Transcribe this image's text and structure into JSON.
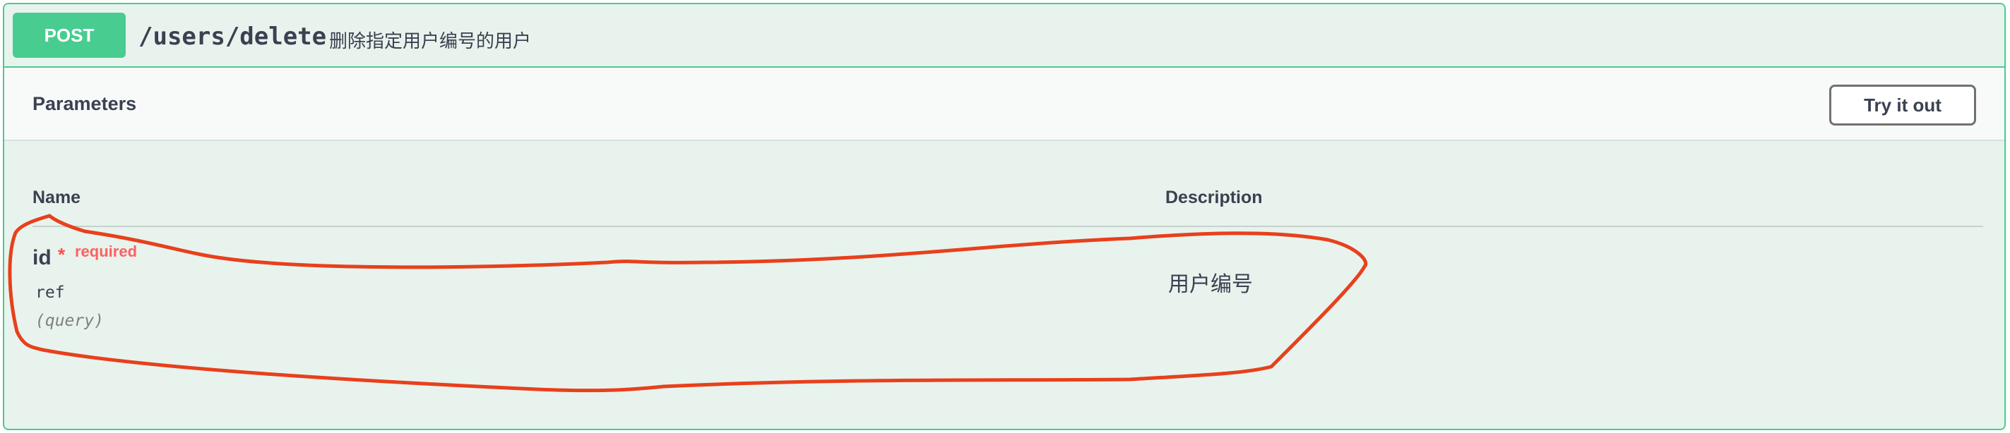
{
  "operation": {
    "method": "POST",
    "path": "/users/delete",
    "summary": "删除指定用户编号的用户"
  },
  "parameters_section": {
    "title": "Parameters",
    "try_it_out_label": "Try it out"
  },
  "table": {
    "headers": {
      "name": "Name",
      "description": "Description"
    },
    "rows": [
      {
        "name": "id",
        "required_star": "*",
        "required_label": "required",
        "type": "ref",
        "location": "(query)",
        "description": "用户编号"
      }
    ]
  },
  "colors": {
    "post_accent": "#49cc90",
    "background": "#e8f3ed",
    "annotation_stroke": "#e8401c",
    "required": "#ff4d4d"
  }
}
